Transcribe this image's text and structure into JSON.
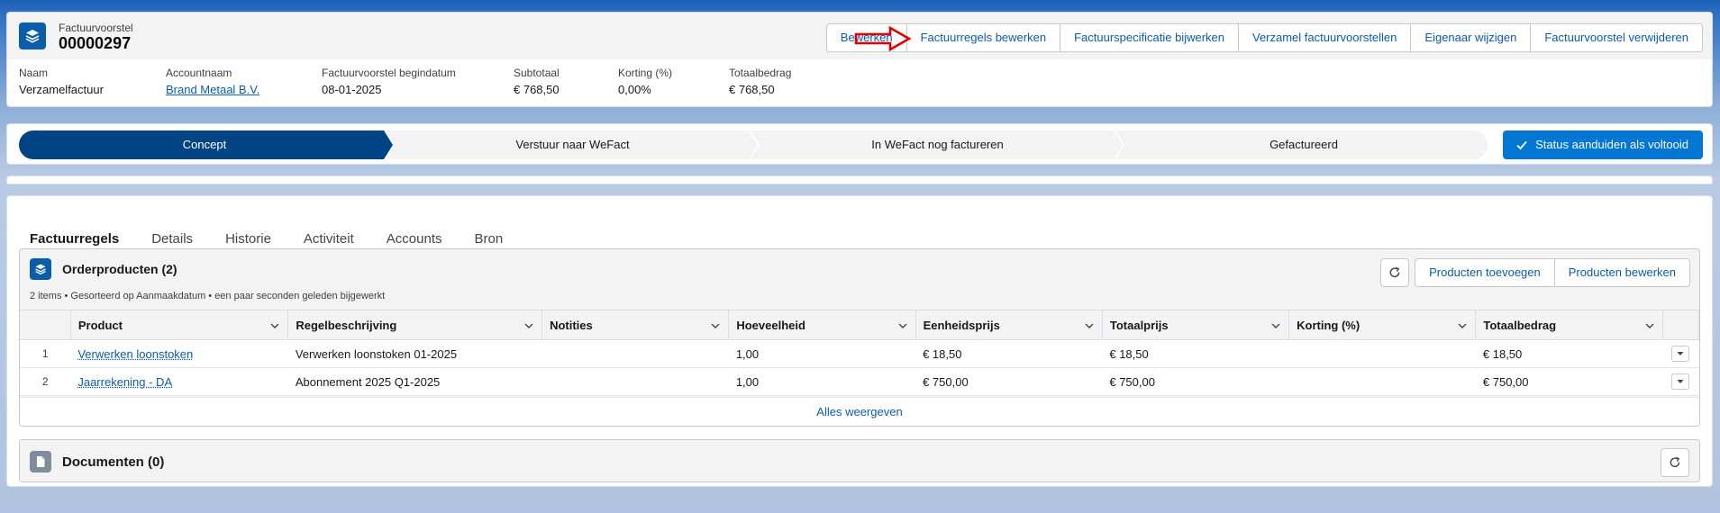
{
  "record": {
    "object_type": "Factuurvoorstel",
    "name": "00000297",
    "actions": [
      "Bewerken",
      "Factuurregels bewerken",
      "Factuurspecificatie bijwerken",
      "Verzamel factuurvoorstellen",
      "Eigenaar wijzigen",
      "Factuurvoorstel verwijderen"
    ],
    "icon": "stack-icon"
  },
  "highlights": [
    {
      "label": "Naam",
      "value": "Verzamelfactuur",
      "link": false
    },
    {
      "label": "Accountnaam",
      "value": "Brand Metaal B.V.",
      "link": true
    },
    {
      "label": "Factuurvoorstel begindatum",
      "value": "08-01-2025",
      "link": false
    },
    {
      "label": "Subtotaal",
      "value": "€ 768,50",
      "link": false
    },
    {
      "label": "Korting (%)",
      "value": "0,00%",
      "link": false
    },
    {
      "label": "Totaalbedrag",
      "value": "€ 768,50",
      "link": false
    }
  ],
  "path": {
    "stages": [
      "Concept",
      "Verstuur naar WeFact",
      "In WeFact nog factureren",
      "Gefactureerd"
    ],
    "active_stage": "Concept",
    "button_label": "Status aanduiden als voltooid"
  },
  "tabs": [
    "Factuurregels",
    "Details",
    "Historie",
    "Activiteit",
    "Accounts",
    "Bron"
  ],
  "active_tab": "Factuurregels",
  "orderproducten": {
    "title": "Orderproducten (2)",
    "info": "2 items • Gesorteerd op Aanmaakdatum • een paar seconden geleden bijgewerkt",
    "add_button": "Producten toevoegen",
    "edit_button": "Producten bewerken",
    "columns": [
      "Product",
      "Regelbeschrijving",
      "Notities",
      "Hoeveelheid",
      "Eenheidsprijs",
      "Totaalprijs",
      "Korting (%)",
      "Totaalbedrag"
    ],
    "rows": [
      {
        "num": "1",
        "product": "Verwerken loonstoken",
        "regel": "Verwerken loonstoken 01-2025",
        "notities": "",
        "hoeveelheid": "1,00",
        "eenheidsprijs": "€ 18,50",
        "totaalprijs": "€ 18,50",
        "korting": "",
        "totaalbedrag": "€ 18,50"
      },
      {
        "num": "2",
        "product": "Jaarrekening - DA",
        "regel": "Abonnement 2025 Q1-2025",
        "notities": "",
        "hoeveelheid": "1,00",
        "eenheidsprijs": "€ 750,00",
        "totaalprijs": "€ 750,00",
        "korting": "",
        "totaalbedrag": "€ 750,00"
      }
    ],
    "view_all": "Alles weergeven"
  },
  "documenten": {
    "title": "Documenten (0)"
  },
  "colors": {
    "brand": "#0b5cab",
    "path_active": "#014486",
    "action_blue": "#0176d3",
    "annotation_red": "#e00000"
  }
}
